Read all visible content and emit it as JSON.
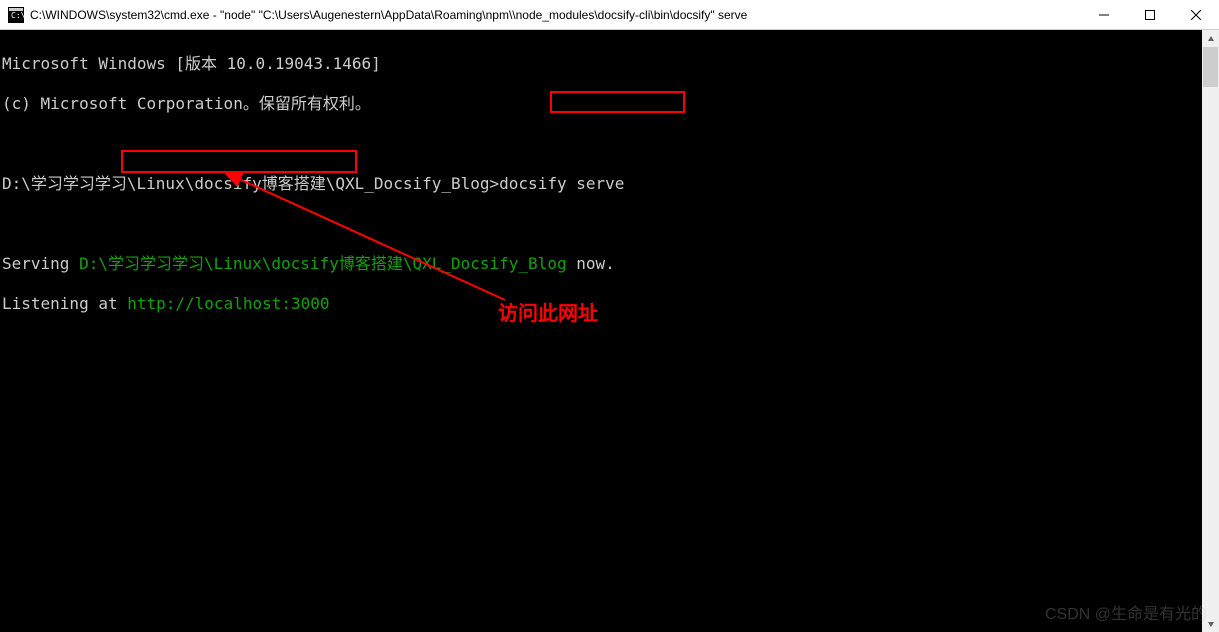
{
  "window": {
    "title": "C:\\WINDOWS\\system32\\cmd.exe  -  \"node\"   \"C:\\Users\\Augenestern\\AppData\\Roaming\\npm\\\\node_modules\\docsify-cli\\bin\\docsify\"  serve"
  },
  "terminal": {
    "line1": "Microsoft Windows [版本 10.0.19043.1466]",
    "line2": "(c) Microsoft Corporation。保留所有权利。",
    "prompt_path": "D:\\学习学习学习\\Linux\\docsify博客搭建\\QXL_Docsify_Blog>",
    "command": "docsify serve",
    "serving_prefix": "Serving ",
    "serving_path": "D:\\学习学习学习\\Linux\\docsify博客搭建\\QXL_Docsify_Blog",
    "serving_suffix": " now.",
    "listening_prefix": "Listening at ",
    "listening_url": "http://localhost:3000"
  },
  "annotation": {
    "label": "访问此网址"
  },
  "watermark": "CSDN @生命是有光的"
}
